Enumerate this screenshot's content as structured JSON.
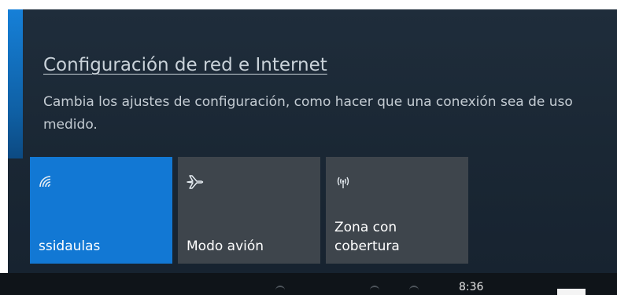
{
  "settings_link": "Configuración de red e Internet",
  "settings_description": "Cambia los ajustes de configuración, como hacer que una conexión sea de uso medido.",
  "tiles": [
    {
      "label": "ssidaulas",
      "icon": "wifi-icon",
      "active": true
    },
    {
      "label": "Modo avión",
      "icon": "airplane-icon",
      "active": false
    },
    {
      "label": "Zona con cobertura",
      "icon": "mobile-hotspot-icon",
      "active": false
    }
  ],
  "taskbar": {
    "clock": "8:36"
  },
  "colors": {
    "accent": "#1278d4",
    "flyout_background": "#1b2835",
    "tile_inactive": "#3e454c"
  }
}
